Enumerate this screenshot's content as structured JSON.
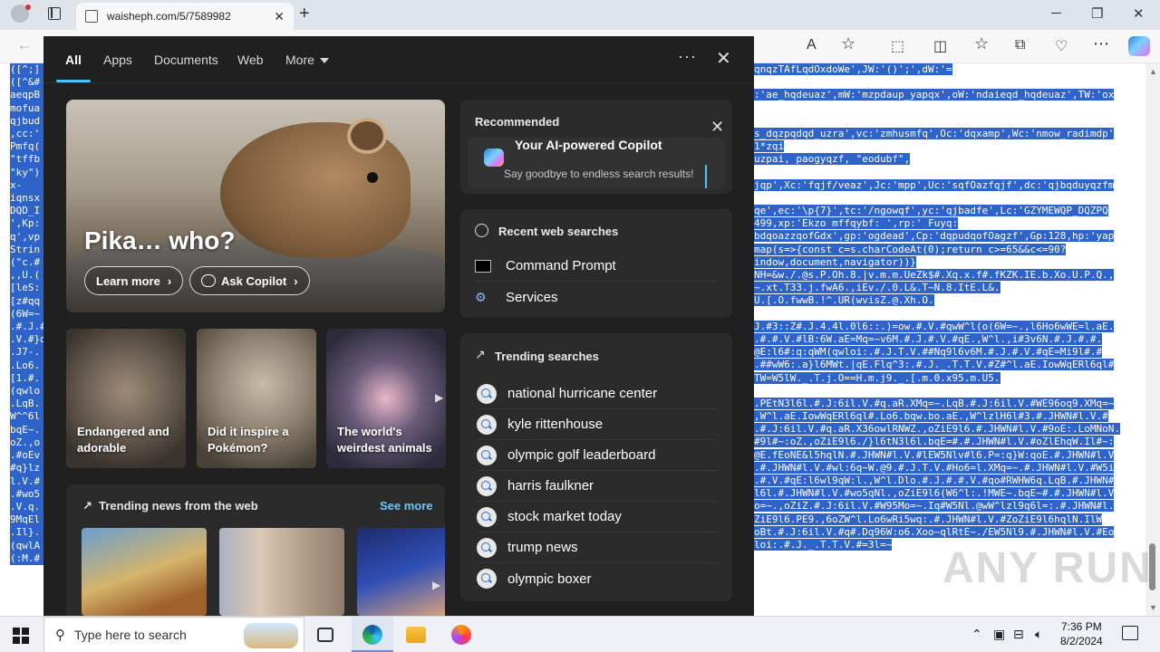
{
  "browser": {
    "tab_title": "waisheph.com/5/7589982",
    "tab_close": "✕",
    "new_tab": "+",
    "window_min": "─",
    "window_max": "❐",
    "window_close": "✕",
    "back": "←",
    "read_aloud": "A",
    "favorite": "☆",
    "extensions": "⬚",
    "split": "◫",
    "favorites_bar": "☆",
    "collections": "⧉",
    "performance": "♡",
    "more": "⋯"
  },
  "page": {
    "left_lines": [
      "([^;]",
      "([^&#",
      "aeqpB",
      "mofua",
      "qjbud",
      ",cc:'",
      "Pmfq(",
      "\"tffb",
      "\"ky\")",
      "x- ",
      "iqnsx",
      "DQD_I",
      "',Kp:",
      "q',vp",
      "Strin",
      "(\"c.#",
      ",,U.(",
      "[leS:",
      "[z#qq",
      "(6W=~",
      ".#.J.#",
      ".V.#}q",
      ".J7-.",
      ".Lo6.",
      "[1.#.",
      "(qwlo",
      ".LqB.",
      "W^^6l",
      "bqE~.",
      "oZ.,o",
      ".#oEv",
      "#q}lz",
      "l.V.#",
      ".#wo5",
      ".V.q.",
      "9MqEl",
      ".Il}.",
      "(qwlA",
      "(:M.#"
    ],
    "right_lines": [
      "qnqzTAfLqdOxdoWe',JW:'()';',dW:'=",
      "",
      ":'ae_hqdeuaz',mW:'mzpdaup_yapqx',oW:'ndaieqd_hqdeuaz',TW:'ox",
      "",
      "",
      "s_dqzpqdqd_uzra',vc:'zmhusmfq',Oc:'dqxamp',Wc:'nmow_radimdp'",
      "1*zqi",
      "uzpai, paogyqzf, \"eodubf\",",
      "",
      "jqp',Xc:'fqjf/veaz',Jc:'mpp',Uc:'sqfOazfqjf',dc:'qjbqduyqzfm",
      "",
      "qe',ec:'\\p{7}',tc:'/ngowqf',yc:'qjbadfe',Lc:'GZYMEWQP_DQZPQ",
      "499,xp:'Ekzo mffqybf: ',rp:' Fuyq:",
      "bdqoazzqofGdx',gp:'ogdead',Cp:'dqpudqofOagzf',Gp:128,hp:'yap",
      "map(s=>{const c=s.charCodeAt(0);return c>=65&&c<=90?",
      "indow,document,navigator))}",
      "NH=&w./.@s.P.Oh.8.|v.m.m.UeZk$#.Xq.x.f#.fKZK.IE.b.Xo.U.P.Q.,",
      "~.xt.T33.j.fwA6.,iEv./.0.L&.T~N.8.ItE.L&.",
      "U.[.O.fwwB.!^.UR(wvisZ.@.Xh.O.",
      "",
      "J.#3::Z#.J.4.4l.0l6::.)=ow.#.V.#qwW^l(o(6W=~.,l6Ho6wWE=l.aE.",
      ".#.#.V.#lB:6W.aE=Mq=~v6M.#.J.#.V.#qE.,W^l.,i#3v6N.#.J.#.#.",
      "@E:l6#:q:qWM(qwloi:.#.J.T.V.##Nq9l6v6M.#.J.#.V.#qE=Mi9l#.#",
      ".##wW6:.a}l6MWt.|qE.Flq^3:.#.J._.T.T.V.#Z#^l.aE.IowWqERl6ql#",
      "TW=W5lW._.T.j.O==H.m.j9._.[.m.0.x95.m.U5.",
      "",
      ".PEtN3l6l.#.J:6il.V.#q.aR.XMq=~.LqB.#.J:6il.V.#WE96oq9.XMq=~",
      ",W^l.aE.IowWqERl6ql#.Lo6.bqw.bo.aE.,W^lzlH6l#3.#.JHWN#l.V.#",
      ".#.J:6il.V.#q.aR.X36owlRNWZ.,oZiE9l6.#.JHWN#l.V.#9oE:.LoMNoN.",
      "#9l#~:oZ.,oZiE9l6./}l6tN3l6l.bqE=#.#.JHWN#l.V.#oZlEhqW.Il#~:",
      "@E.fEoNE&l5hqlN.#.JHWN#l.V.#lEW5Nlv#l6.P=:q}W:qoE.#.JHWN#l.V",
      ".#.JHWN#l.V.#wl:6q~W.@9.#.J.T.V.#Ho6=l.XMq=~.#.JHWN#l.V.#W5i",
      ".#.V.#qE:l6wl9qW:l.,W^l.Dlo.#.J.#.#.V.#qo#RWHW6q.LqB.#.JHWN#",
      "l6l.#.JHWN#l.V.#wo5qNl.,oZiE9l6(W6^l:.!MWE~.bqE~#.#.JHWN#l.V",
      "o=~.,oZiZ.#.J:6il.V.#W95Mo=~.Iq#W5Nl.@wW^lzl9q6l=:.#.JHWN#l.",
      "ZiE9l6.PE9.,6oZW^l.Lo6wRi5wq:.#.JHWN#l.V.#ZoZiE9l6hqlN.IlW",
      "oBt.#.J:6il.V.#q#.Dq96W:o6.Xoo~qlRtE~./EW5Nl9.#.JHWN#l.V.#Eo",
      "loi:.#.J._.T.T.V.#=3l=~"
    ],
    "watermark": "ANY RUN"
  },
  "panel": {
    "tabs": [
      "All",
      "Apps",
      "Documents",
      "Web",
      "More"
    ],
    "more_menu": "···",
    "close": "✕",
    "hero": {
      "title": "Pika… who?",
      "learn_more": "Learn more",
      "ask_copilot": "Ask Copilot"
    },
    "cards": [
      {
        "caption": "Endangered and adorable"
      },
      {
        "caption": "Did it inspire a Pokémon?"
      },
      {
        "caption": "The world's weirdest animals"
      }
    ],
    "news": {
      "heading": "Trending news from the web",
      "see_more": "See more"
    },
    "recommended": {
      "heading": "Recommended",
      "title": "Your AI-powered Copilot",
      "subtitle": "Say goodbye to endless search results!"
    },
    "recent": {
      "heading": "Recent web searches",
      "items": [
        "Command Prompt",
        "Services"
      ]
    },
    "trending": {
      "heading": "Trending searches",
      "items": [
        "national hurricane center",
        "kyle rittenhouse",
        "olympic golf leaderboard",
        "harris faulkner",
        "stock market today",
        "trump news",
        "olympic boxer"
      ]
    }
  },
  "taskbar": {
    "search_placeholder": "Type here to search",
    "time": "7:36 PM",
    "date": "8/2/2024"
  }
}
